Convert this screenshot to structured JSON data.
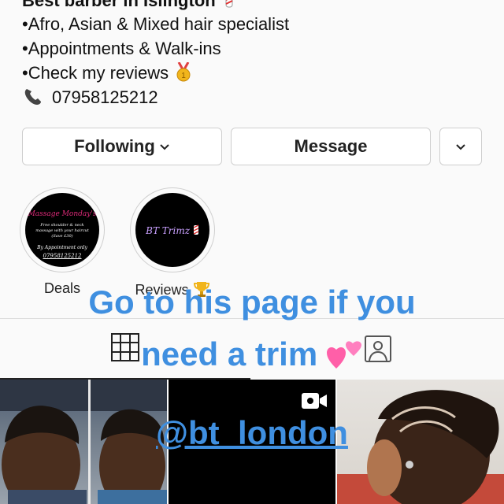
{
  "profile": {
    "bio": {
      "line1": "Best barber in Islington",
      "line2": "•Afro, Asian & Mixed hair specialist",
      "line3": "•Appointments & Walk-ins",
      "line4": "•Check my reviews",
      "line4_icon": "first-place-medal-icon",
      "phone": "07958125212",
      "phone_icon": "telephone-icon"
    },
    "actions": {
      "following_label": "Following",
      "message_label": "Message"
    }
  },
  "highlights": [
    {
      "label": "Deals",
      "cover_title": "Massage Monday's",
      "cover_text": "Free shoulder & neck massage with your haircut (Save £30)",
      "cover_footer": "By Appointment only",
      "cover_phone": "07958125212"
    },
    {
      "label": "Reviews",
      "label_icon": "trophy-icon",
      "cover_title": "BT Trimz"
    }
  ],
  "story_overlay": {
    "line1": "Go to his page if you",
    "line2": "need a trim",
    "line2_icon": "two-hearts-icon",
    "mention": "@bt_london"
  },
  "tabs": [
    "grid-icon",
    "tagged-icon"
  ],
  "posts": [
    {
      "type": "photo"
    },
    {
      "type": "video",
      "icon": "video-icon"
    },
    {
      "type": "photo"
    }
  ],
  "colors": {
    "accent": "#3f8fe0",
    "highlight_text": "#c9a0ff"
  }
}
